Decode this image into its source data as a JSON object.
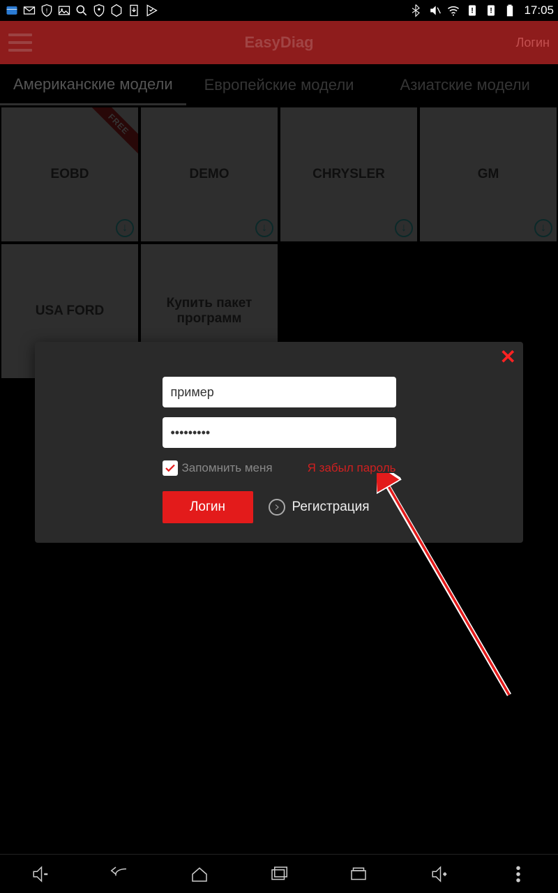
{
  "status": {
    "time": "17:05"
  },
  "header": {
    "title": "EasyDiag",
    "login": "Логин"
  },
  "tabs": [
    {
      "label": "Американские модели",
      "active": true
    },
    {
      "label": "Европейские модели",
      "active": false
    },
    {
      "label": "Азиатские модели",
      "active": false
    }
  ],
  "cards": [
    {
      "label": "EOBD",
      "free": true,
      "download": true
    },
    {
      "label": "DEMO",
      "free": false,
      "download": true
    },
    {
      "label": "CHRYSLER",
      "free": false,
      "download": true
    },
    {
      "label": "GM",
      "free": false,
      "download": true
    },
    {
      "label": "USA FORD",
      "free": false,
      "download": false
    },
    {
      "label": "Купить пакет программ",
      "free": false,
      "download": false
    }
  ],
  "free_ribbon_text": "FREE",
  "modal": {
    "username_value": "пример",
    "password_value": "•••••••••",
    "remember_label": "Запомнить меня",
    "forgot_label": "Я забыл пароль",
    "login_button": "Логин",
    "register_label": "Регистрация"
  },
  "colors": {
    "brand_red": "#8e1c1c",
    "accent_red": "#e31b1b",
    "link_red": "#d02020"
  }
}
